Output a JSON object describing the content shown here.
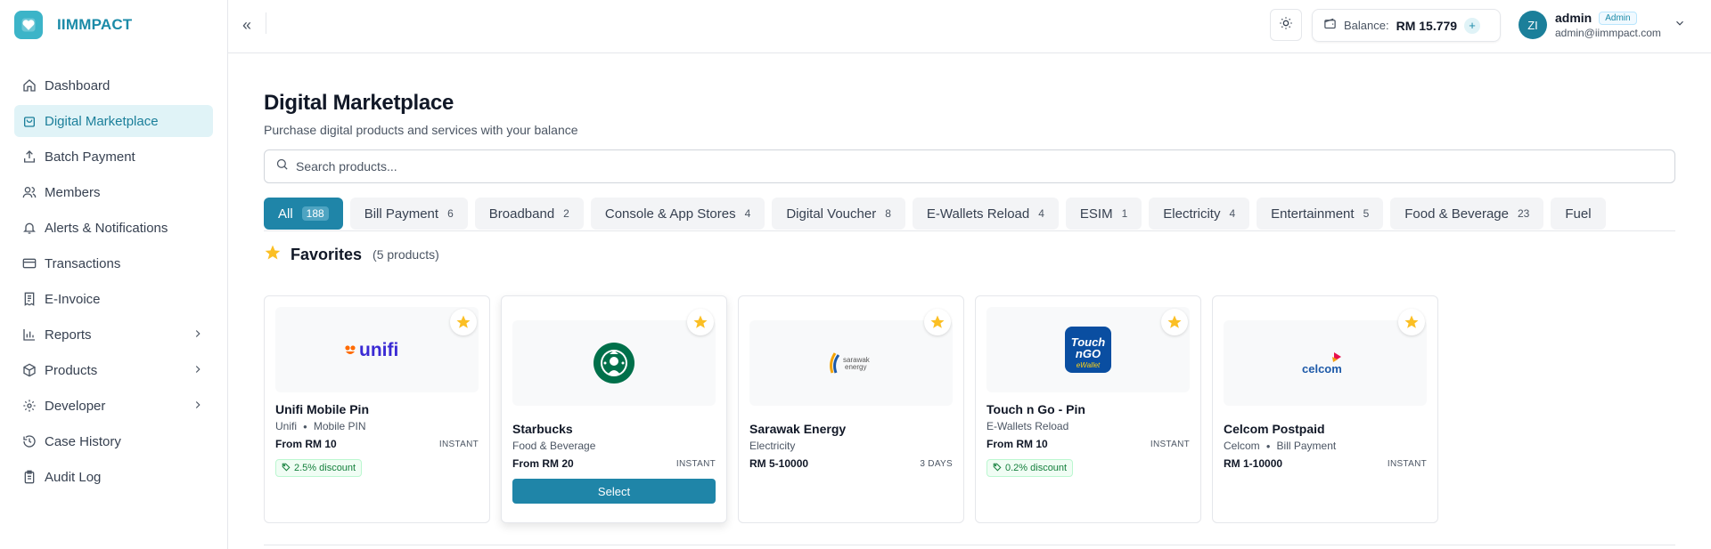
{
  "brand": {
    "name": "IIMMPACT"
  },
  "sidebar": {
    "items": [
      {
        "label": "Dashboard",
        "icon": "home-icon"
      },
      {
        "label": "Digital Marketplace",
        "icon": "shopping-bag-icon",
        "active": true
      },
      {
        "label": "Batch Payment",
        "icon": "upload-icon"
      },
      {
        "label": "Members",
        "icon": "users-icon"
      },
      {
        "label": "Alerts & Notifications",
        "icon": "bell-icon"
      },
      {
        "label": "Transactions",
        "icon": "credit-card-icon"
      },
      {
        "label": "E-Invoice",
        "icon": "receipt-icon"
      },
      {
        "label": "Reports",
        "icon": "bar-chart-icon",
        "expandable": true
      },
      {
        "label": "Products",
        "icon": "package-icon",
        "expandable": true
      },
      {
        "label": "Developer",
        "icon": "gear-icon",
        "expandable": true
      },
      {
        "label": "Case History",
        "icon": "history-icon"
      },
      {
        "label": "Audit Log",
        "icon": "clipboard-icon"
      }
    ]
  },
  "header": {
    "collapse": "«",
    "balance_label": "Balance:",
    "balance_value": "RM 15.779",
    "balance_add": "+",
    "user": {
      "initials": "ZI",
      "name": "admin",
      "role": "Admin",
      "email": "admin@iimmpact.com"
    }
  },
  "main": {
    "title": "Digital Marketplace",
    "subtitle": "Purchase digital products and services with your balance",
    "search_placeholder": "Search products...",
    "categories": [
      {
        "label": "All",
        "count": "188",
        "active": true
      },
      {
        "label": "Bill Payment",
        "count": "6"
      },
      {
        "label": "Broadband",
        "count": "2"
      },
      {
        "label": "Console & App Stores",
        "count": "4"
      },
      {
        "label": "Digital Voucher",
        "count": "8"
      },
      {
        "label": "E-Wallets Reload",
        "count": "4"
      },
      {
        "label": "ESIM",
        "count": "1"
      },
      {
        "label": "Electricity",
        "count": "4"
      },
      {
        "label": "Entertainment",
        "count": "5"
      },
      {
        "label": "Food & Beverage",
        "count": "23"
      },
      {
        "label": "Fuel",
        "count": ""
      }
    ],
    "favorites": {
      "title": "Favorites",
      "count": "(5 products)",
      "items": [
        {
          "name": "Unifi Mobile Pin",
          "brand": "Unifi",
          "category": "Mobile PIN",
          "price": "From RM 10",
          "speed": "INSTANT",
          "discount": "2.5% discount",
          "logo": "unifi"
        },
        {
          "name": "Starbucks",
          "brand": "",
          "category": "Food & Beverage",
          "price": "From RM 20",
          "speed": "INSTANT",
          "select_label": "Select",
          "logo": "starbucks"
        },
        {
          "name": "Sarawak Energy",
          "brand": "",
          "category": "Electricity",
          "price": "RM 5-10000",
          "speed": "3 DAYS",
          "logo": "sarawak energy"
        },
        {
          "name": "Touch n Go - Pin",
          "brand": "",
          "category": "E-Wallets Reload",
          "price": "From RM 10",
          "speed": "INSTANT",
          "discount": "0.2% discount",
          "logo": "touch n go ewallet"
        },
        {
          "name": "Celcom Postpaid",
          "brand": "Celcom",
          "category": "Bill Payment",
          "price": "RM 1-10000",
          "speed": "INSTANT",
          "logo": "celcom"
        }
      ]
    }
  },
  "colors": {
    "accent": "#1f85a8",
    "brand": "#1b8ba8",
    "star": "#fbbf24",
    "discount": "#15803d"
  }
}
